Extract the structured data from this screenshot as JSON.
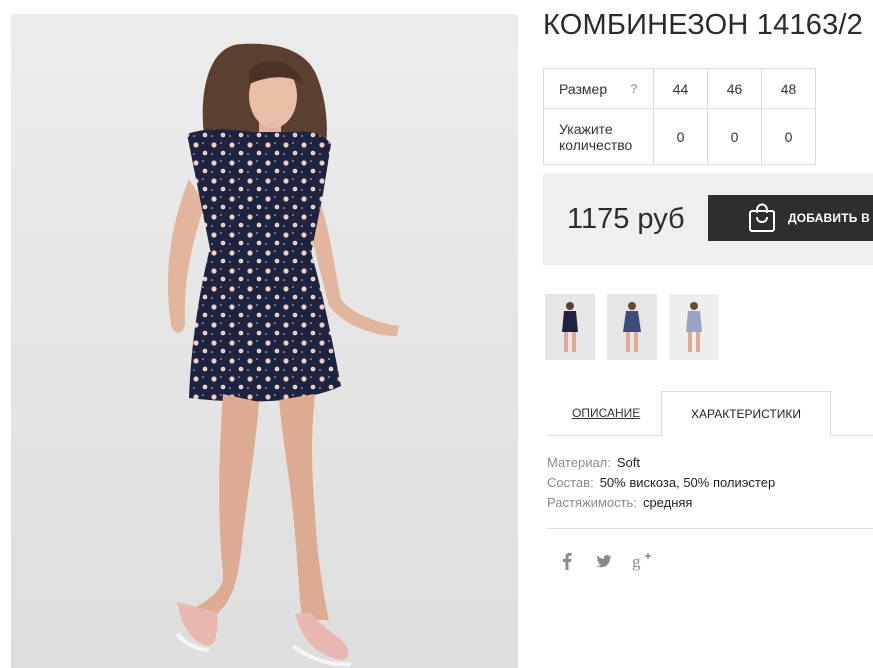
{
  "product": {
    "title": "КОМБИНЕЗОН 14163/2",
    "size_table": {
      "size_label": "Размер",
      "help_symbol": "?",
      "qty_label_line1": "Укажите",
      "qty_label_line2": "количество",
      "sizes": [
        "44",
        "46",
        "48"
      ],
      "quantities": [
        "0",
        "0",
        "0"
      ]
    },
    "price": "1175 руб",
    "add_to_cart_label": "ДОБАВИТЬ В КОРЗИНУ"
  },
  "tabs": [
    {
      "label": "ОПИСАНИЕ",
      "active": false
    },
    {
      "label": "ХАРАКТЕРИСТИКИ",
      "active": true
    }
  ],
  "characteristics": [
    {
      "key": "Материал:",
      "value": "Soft"
    },
    {
      "key": "Состав:",
      "value": "50% вискоза, 50% полиэстер"
    },
    {
      "key": "Растяжимость:",
      "value": "средняя"
    }
  ],
  "social": [
    {
      "icon": "facebook-icon",
      "glyph": "f"
    },
    {
      "icon": "twitter-icon",
      "glyph": "t"
    },
    {
      "icon": "google-plus-icon",
      "glyph": "g+"
    }
  ],
  "colors": {
    "dress": "#1f2340",
    "button": "#2e2e2e",
    "price_bg": "#efefef",
    "border": "#dcdcdc",
    "muted": "#8a8a8a"
  }
}
